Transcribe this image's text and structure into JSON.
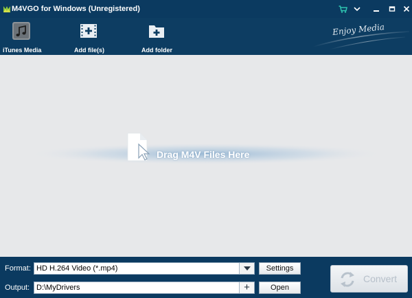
{
  "window": {
    "title": "M4VGO for Windows (Unregistered)"
  },
  "toolbar": {
    "itunes_label": "iTunes Media",
    "add_files_label": "Add file(s)",
    "add_folder_label": "Add folder"
  },
  "banner": {
    "text": "Enjoy Media"
  },
  "drop_area": {
    "text": "Drag M4V Files Here"
  },
  "bottom": {
    "format_label": "Format:",
    "format_value": "HD H.264 Video (*.mp4)",
    "output_label": "Output:",
    "output_value": "D:\\MyDrivers",
    "plus_label": "+",
    "settings_label": "Settings",
    "open_label": "Open",
    "convert_label": "Convert"
  },
  "colors": {
    "titlebar": "#0b3a60",
    "toolbar": "#0d3d62",
    "drop_area": "#e7e8ea",
    "cart_icon": "#2ec4b0"
  },
  "icons": {
    "app_logo": "m-logo-icon",
    "cart": "shopping-cart-icon",
    "menu": "chevron-down-icon",
    "minimize": "minimize-icon",
    "maximize": "maximize-icon",
    "close": "close-icon",
    "itunes": "music-note-icon",
    "add_files": "film-plus-icon",
    "add_folder": "folder-plus-icon",
    "drag": "document-cursor-icon",
    "convert": "refresh-icon"
  }
}
